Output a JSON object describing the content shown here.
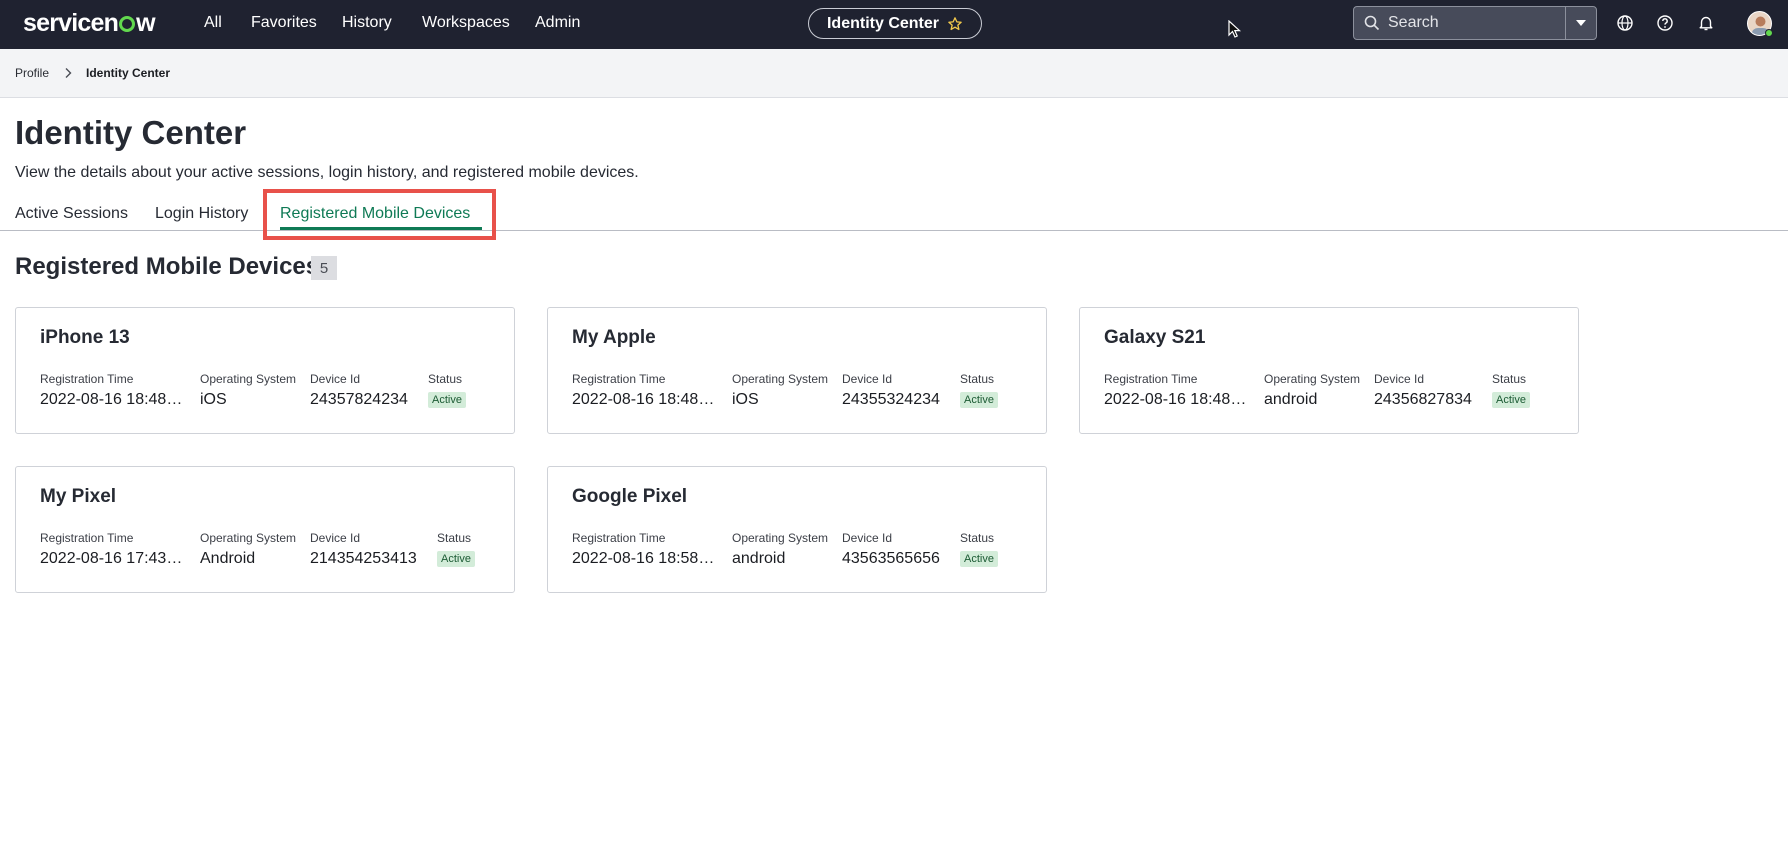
{
  "topnav": {
    "logo": "servicenow",
    "links": [
      "All",
      "Favorites",
      "History",
      "Workspaces",
      "Admin"
    ],
    "center_title": "Identity Center",
    "search_placeholder": "Search",
    "icons": [
      "globe-icon",
      "help-icon",
      "bell-icon",
      "user-avatar"
    ]
  },
  "breadcrumb": {
    "parent": "Profile",
    "current": "Identity Center"
  },
  "page": {
    "title": "Identity Center",
    "description": "View the details about your active sessions, login history, and registered mobile devices."
  },
  "tabs": [
    {
      "label": "Active Sessions",
      "active": false
    },
    {
      "label": "Login History",
      "active": false
    },
    {
      "label": "Registered Mobile Devices",
      "active": true
    }
  ],
  "section": {
    "title": "Registered Mobile Devices",
    "count": "5"
  },
  "field_labels": {
    "registration_time": "Registration Time",
    "operating_system": "Operating System",
    "device_id": "Device Id",
    "status": "Status"
  },
  "devices": [
    {
      "name": "iPhone 13",
      "registration_time": "2022-08-16 18:48…",
      "os": "iOS",
      "device_id": "24357824234",
      "status": "Active"
    },
    {
      "name": "My Apple",
      "registration_time": "2022-08-16 18:48…",
      "os": "iOS",
      "device_id": "24355324234",
      "status": "Active"
    },
    {
      "name": "Galaxy S21",
      "registration_time": "2022-08-16 18:48…",
      "os": "android",
      "device_id": "24356827834",
      "status": "Active"
    },
    {
      "name": "My Pixel",
      "registration_time": "2022-08-16 17:43…",
      "os": "Android",
      "device_id": "214354253413",
      "status": "Active"
    },
    {
      "name": "Google Pixel",
      "registration_time": "2022-08-16 18:58…",
      "os": "android",
      "device_id": "43563565656",
      "status": "Active"
    }
  ],
  "colors": {
    "nav_bg": "#1f2230",
    "brand_green": "#62d84e",
    "tab_active": "#0f7a55",
    "highlight": "#e8514a",
    "status_bg": "#d3ecd9"
  }
}
